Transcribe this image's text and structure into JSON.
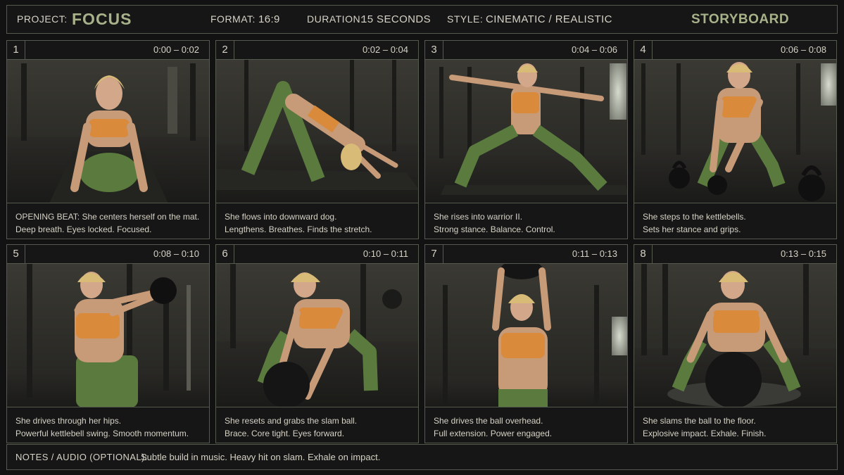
{
  "header": {
    "project_label": "PROJECT:",
    "project_value": "FOCUS",
    "format_label": "FORMAT:",
    "format_value": "16:9",
    "duration_label": "DURATION:",
    "duration_value": "15 SECONDS",
    "style_label": "STYLE:",
    "style_value": "CINEMATIC / REALISTIC",
    "title": "STORYBOARD"
  },
  "panels": [
    {
      "number": "1",
      "time": "0:00 – 0:02",
      "line1": "OPENING BEAT: She centers herself on the mat.",
      "line2": "Deep breath. Eyes locked. Focused."
    },
    {
      "number": "2",
      "time": "0:02 – 0:04",
      "line1": "She flows into downward dog.",
      "line2": "Lengthens. Breathes. Finds the stretch."
    },
    {
      "number": "3",
      "time": "0:04 – 0:06",
      "line1": "She rises into warrior II.",
      "line2": "Strong stance. Balance. Control."
    },
    {
      "number": "4",
      "time": "0:06 – 0:08",
      "line1": "She steps to the kettlebells.",
      "line2": "Sets her stance and grips."
    },
    {
      "number": "5",
      "time": "0:08 – 0:10",
      "line1": "She drives through her hips.",
      "line2": "Powerful kettlebell swing. Smooth momentum."
    },
    {
      "number": "6",
      "time": "0:10 – 0:11",
      "line1": "She resets and grabs the slam ball.",
      "line2": "Brace. Core tight. Eyes forward."
    },
    {
      "number": "7",
      "time": "0:11 – 0:13",
      "line1": "She drives the ball overhead.",
      "line2": "Full extension. Power engaged."
    },
    {
      "number": "8",
      "time": "0:13 – 0:15",
      "line1": "She slams the ball to the floor.",
      "line2": "Explosive impact. Exhale. Finish."
    }
  ],
  "notes": {
    "label": "NOTES / AUDIO (OPTIONAL):",
    "text": "Subtle build in music. Heavy hit on slam. Exhale on impact."
  },
  "colors": {
    "accent": "#a8b28a",
    "border": "#555a4e",
    "background": "#121212",
    "outfit_top": "#d98a3a",
    "outfit_legs": "#5a7a3e"
  }
}
